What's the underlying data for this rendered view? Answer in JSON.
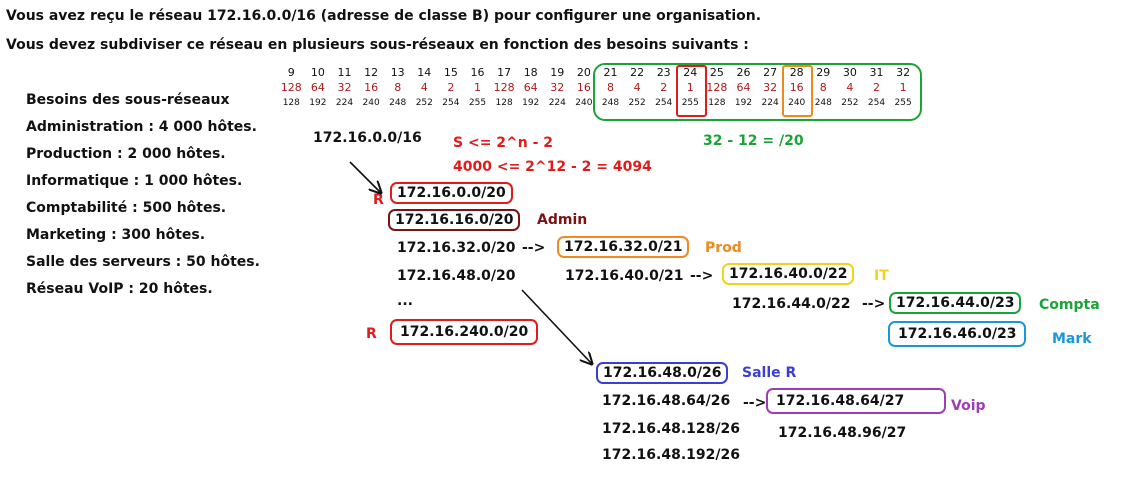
{
  "intro": {
    "line1": "Vous avez reçu le réseau 172.16.0.0/16 (adresse de classe B) pour configurer une organisation.",
    "line2": "Vous devez subdiviser ce réseau en plusieurs sous-réseaux en fonction des besoins suivants :"
  },
  "requirements": {
    "title": "Besoins des sous-réseaux",
    "items": [
      "Administration : 4 000 hôtes.",
      "Production : 2 000 hôtes.",
      "Informatique : 1 000 hôtes.",
      "Comptabilité : 500 hôtes.",
      "Marketing : 300 hôtes.",
      "Salle des serveurs : 50 hôtes.",
      "Réseau VoIP : 20 hôtes."
    ]
  },
  "bit_table": {
    "bits": [
      "9",
      "10",
      "11",
      "12",
      "13",
      "14",
      "15",
      "16",
      "17",
      "18",
      "19",
      "20",
      "21",
      "22",
      "23",
      "24",
      "25",
      "26",
      "27",
      "28",
      "29",
      "30",
      "31",
      "32"
    ],
    "values": [
      "128",
      "64",
      "32",
      "16",
      "8",
      "4",
      "2",
      "1",
      "128",
      "64",
      "32",
      "16",
      "8",
      "4",
      "2",
      "1",
      "128",
      "64",
      "32",
      "16",
      "8",
      "4",
      "2",
      "1"
    ],
    "masks": [
      "128",
      "192",
      "224",
      "240",
      "248",
      "252",
      "254",
      "255",
      "128",
      "192",
      "224",
      "240",
      "248",
      "252",
      "254",
      "255",
      "128",
      "192",
      "224",
      "240",
      "248",
      "252",
      "254",
      "255"
    ]
  },
  "formulas": {
    "base_network": "172.16.0.0/16",
    "rule": "S <= 2^n - 2",
    "calc": "4000 <= 2^12 - 2 = 4094",
    "prefix": "32 - 12 = /20"
  },
  "subnets": {
    "r_label": "R",
    "s20_0": "172.16.0.0/20",
    "s20_16": "172.16.16.0/20",
    "admin_label": "Admin",
    "s20_32": "172.16.32.0/20",
    "arrow": "-->",
    "s21_32": "172.16.32.0/21",
    "prod_label": "Prod",
    "s20_48": "172.16.48.0/20",
    "s21_40": "172.16.40.0/21",
    "s22_40": "172.16.40.0/22",
    "it_label": "IT",
    "dots": "...",
    "s22_44": "172.16.44.0/22",
    "s23_44": "172.16.44.0/23",
    "compta_label": "Compta",
    "s20_240": "172.16.240.0/20",
    "r2_label": "R",
    "s23_46": "172.16.46.0/23",
    "mark_label": "Mark",
    "s26_0": "172.16.48.0/26",
    "salle_label": "Salle R",
    "s26_64": "172.16.48.64/26",
    "arrow2": "-->",
    "s27_64": "172.16.48.64/27",
    "voip_label": "Voip",
    "s26_128": "172.16.48.128/26",
    "s27_96": "172.16.48.96/27",
    "s26_192": "172.16.48.192/26"
  },
  "colors": {
    "red": "#e01b1b",
    "darkred": "#7a1313",
    "orange": "#f08a1f",
    "yellow": "#f2d21b",
    "green": "#1aa338",
    "blue": "#1a97d8",
    "indigo": "#3b3fcf",
    "purple": "#a03cb6"
  }
}
